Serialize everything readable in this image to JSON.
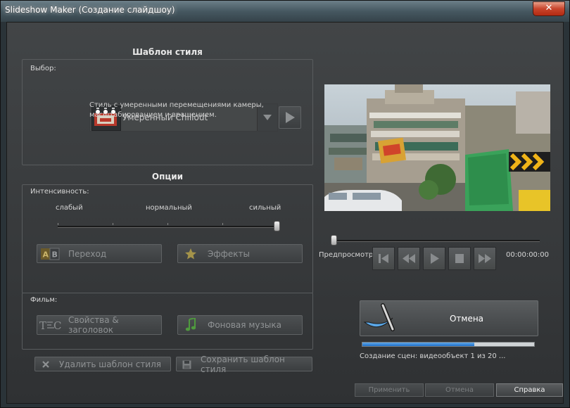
{
  "window": {
    "title": "Slideshow Maker (Создание слайдшоу)",
    "close_label": "✕"
  },
  "style_template": {
    "section_title": "Шаблон стиля",
    "choice_label": "Выбор:",
    "selected": "Умеренный Chillout",
    "description_line1": "Стиль с умеренными перемещениями камеры,",
    "description_line2": "масштабированием и вращением."
  },
  "options": {
    "section_title": "Опции",
    "intensity_label": "Интенсивность:",
    "levels": [
      "слабый",
      "нормальный",
      "сильный"
    ],
    "intensity_value": 1.0,
    "transition_button": "Переход",
    "effects_button": "Эффекты"
  },
  "film": {
    "label": "Фильм:",
    "properties_button": "Свойства & заголовок",
    "music_button": "Фоновая музыка"
  },
  "template_actions": {
    "delete_button": "Удалить шаблон стиля",
    "save_button": "Сохранить шаблон стиля"
  },
  "preview": {
    "label": "Предпросмотр",
    "timecode": "00:00:00:00",
    "scrubber_position": 0.0
  },
  "progress": {
    "cancel_button": "Отмена",
    "status": "Создание сцен: видеообъект 1 из 20 ...",
    "fraction": 0.65
  },
  "footer": {
    "apply_button": "Применить",
    "cancel_button": "Отмена",
    "help_button": "Справка"
  },
  "colors": {
    "accent": "#1f6fc8",
    "background": "#2f3133",
    "text": "#d6d6d6"
  }
}
